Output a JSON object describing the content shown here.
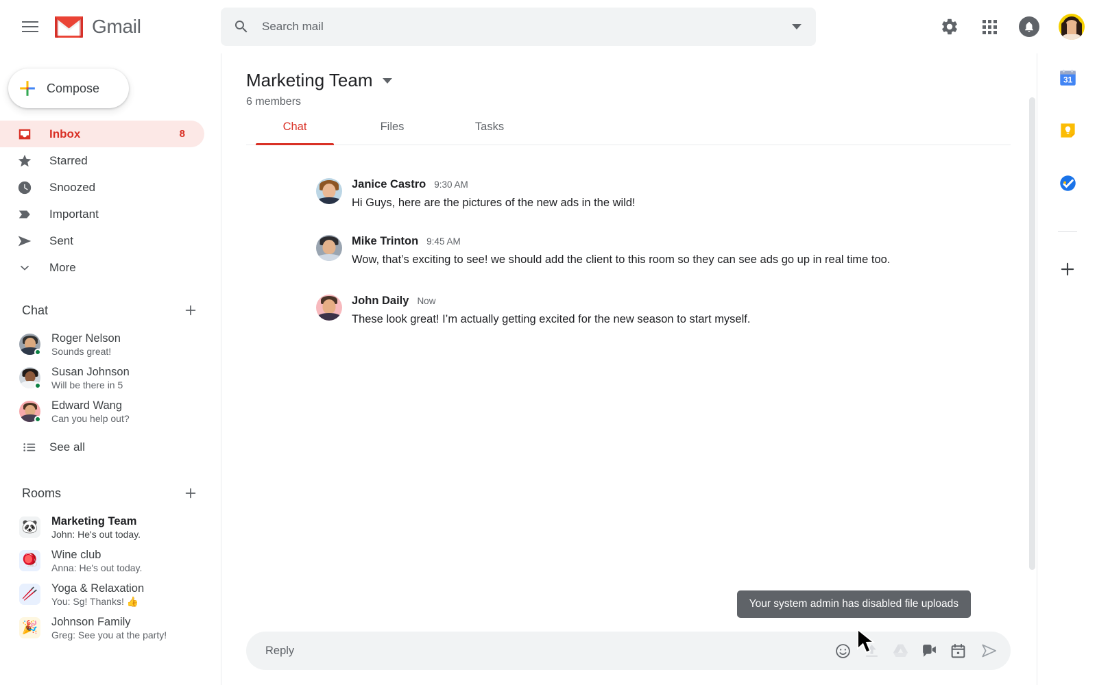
{
  "app": {
    "name": "Gmail",
    "logo_icon": "gmail-m-logo",
    "menu_icon": "hamburger-icon"
  },
  "search": {
    "placeholder": "Search mail",
    "value": "",
    "icon": "search-icon",
    "options_icon": "chevron-down-icon"
  },
  "topbar": {
    "settings_icon": "gear-icon",
    "apps_icon": "apps-grid-icon",
    "notifications_icon": "bell-icon",
    "avatar": "user-avatar"
  },
  "sidebar": {
    "compose": {
      "label": "Compose",
      "icon": "plus-icon"
    },
    "nav": [
      {
        "label": "Inbox",
        "icon": "inbox-icon",
        "count": "8",
        "active": true
      },
      {
        "label": "Starred",
        "icon": "star-icon",
        "count": "",
        "active": false
      },
      {
        "label": "Snoozed",
        "icon": "clock-icon",
        "count": "",
        "active": false
      },
      {
        "label": "Important",
        "icon": "label-icon",
        "count": "",
        "active": false
      },
      {
        "label": "Sent",
        "icon": "send-icon",
        "count": "",
        "active": false
      },
      {
        "label": "More",
        "icon": "chevron-down-icon",
        "count": "",
        "active": false
      }
    ],
    "chat_section": {
      "title": "Chat",
      "add_icon": "plus-icon",
      "contacts": [
        {
          "name": "Roger Nelson",
          "snippet": "Sounds great!",
          "presence": "online"
        },
        {
          "name": "Susan Johnson",
          "snippet": "Will be there in 5",
          "presence": "online"
        },
        {
          "name": "Edward Wang",
          "snippet": "Can you help out?",
          "presence": "online"
        }
      ],
      "see_all": {
        "label": "See all",
        "icon": "list-icon"
      }
    },
    "rooms_section": {
      "title": "Rooms",
      "add_icon": "plus-icon",
      "rooms": [
        {
          "name": "Marketing Team",
          "snippet": "John: He's out today.",
          "emoji": "🐼",
          "bg": "#f1f3f4",
          "unread": true
        },
        {
          "name": "Wine club",
          "snippet": "Anna: He's out today.",
          "emoji": "🪀",
          "bg": "#e8f0fe",
          "unread": false
        },
        {
          "name": "Yoga & Relaxation",
          "snippet": "You: Sg! Thanks! 👍",
          "emoji": "🥢",
          "bg": "#e8f0fe",
          "unread": false
        },
        {
          "name": "Johnson Family",
          "snippet": "Greg: See you at the party!",
          "emoji": "🎉",
          "bg": "#fef7e0",
          "unread": false
        }
      ]
    }
  },
  "room": {
    "title": "Marketing Team",
    "title_dropdown_icon": "chevron-down-icon",
    "members": "6 members",
    "tabs": [
      {
        "label": "Chat",
        "active": true
      },
      {
        "label": "Files",
        "active": false
      },
      {
        "label": "Tasks",
        "active": false
      }
    ],
    "messages": [
      {
        "author": "Janice Castro",
        "time": "9:30 AM",
        "text": "Hi Guys, here are the pictures of the new ads in the wild!",
        "avatar_bg": "#bcd6e5",
        "skin": "#e9b894",
        "hair": "#8d5524",
        "shirt": "#283347"
      },
      {
        "author": "Mike Trinton",
        "time": "9:45 AM",
        "text": "Wow, that’s exciting to see! we should add the client to this room so they can see ads go up in real time too.",
        "avatar_bg": "#9aa5b1",
        "skin": "#e2b28c",
        "hair": "#2c2c30",
        "shirt": "#cfd8e3"
      },
      {
        "author": "John Daily",
        "time": "Now",
        "text": "These look great! I’m actually getting excited for the new season to start myself.",
        "avatar_bg": "#f7b9bd",
        "skin": "#e6ae85",
        "hair": "#4a3428",
        "shirt": "#3c3248"
      }
    ]
  },
  "composer": {
    "placeholder": "Reply",
    "value": "",
    "tooltip": "Your system admin has disabled file uploads",
    "actions": [
      {
        "name": "emoji-icon",
        "disabled": false
      },
      {
        "name": "upload-icon",
        "disabled": true
      },
      {
        "name": "google-drive-icon",
        "disabled": true
      },
      {
        "name": "video-call-icon",
        "disabled": false
      },
      {
        "name": "calendar-invite-icon",
        "disabled": false
      },
      {
        "name": "send-icon",
        "disabled": false
      }
    ],
    "cursor": "mouse-pointer"
  },
  "rail": {
    "items": [
      {
        "name": "google-calendar-icon",
        "badge": "31"
      },
      {
        "name": "google-keep-icon",
        "badge": ""
      },
      {
        "name": "google-tasks-icon",
        "badge": ""
      },
      {
        "name": "add-apps-icon",
        "badge": ""
      }
    ]
  },
  "colors": {
    "gmail_red": "#d93025",
    "accent_blue": "#1a73e8",
    "presence_green": "#0b8043",
    "surface_gray": "#f1f3f4",
    "tooltip_gray": "#5f6368",
    "text_primary": "#202124",
    "text_secondary": "#5f6368"
  }
}
